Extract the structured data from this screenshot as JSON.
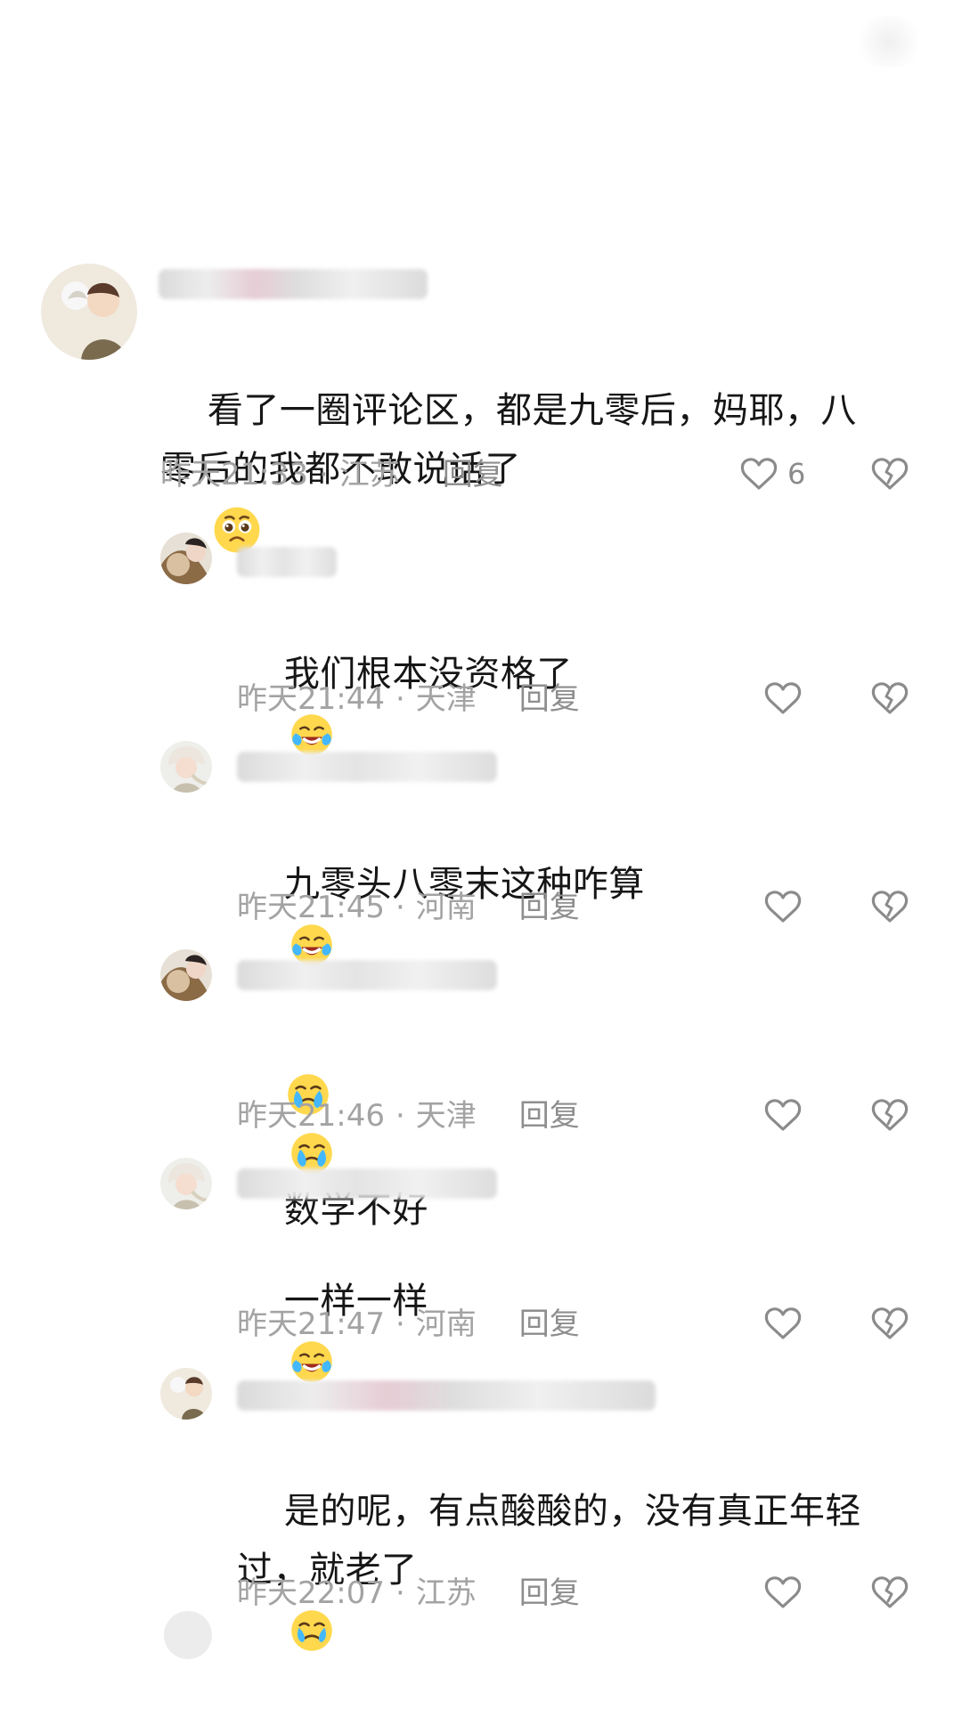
{
  "comments": [
    {
      "type": "main",
      "text": "看了一圈评论区，都是九零后，妈耶，八零后的我都不敢说话了",
      "time": "昨天21:33",
      "location": "江苏",
      "reply_label": "回复",
      "like_count": "6",
      "emoji_after": "pleading"
    },
    {
      "type": "reply",
      "text": "我们根本没资格了",
      "time": "昨天21:44",
      "location": "天津",
      "reply_label": "回复",
      "like_count": "",
      "emoji_after": "laughing"
    },
    {
      "type": "reply",
      "text": "九零头八零末这种咋算",
      "time": "昨天21:45",
      "location": "河南",
      "reply_label": "回复",
      "like_count": "",
      "emoji_after": "laughing"
    },
    {
      "type": "reply",
      "text": "数学不好",
      "time": "昨天21:46",
      "location": "天津",
      "reply_label": "回复",
      "like_count": "",
      "emoji_before": [
        "crying",
        "crying"
      ]
    },
    {
      "type": "reply",
      "text": "一样一样",
      "time": "昨天21:47",
      "location": "河南",
      "reply_label": "回复",
      "like_count": "",
      "emoji_after": "laughing"
    },
    {
      "type": "reply",
      "text": "是的呢，有点酸酸的，没有真正年轻过，就老了",
      "time": "昨天22:07",
      "location": "江苏",
      "reply_label": "回复",
      "like_count": "",
      "emoji_after": "sad"
    }
  ],
  "icons": {
    "like": "heart-outline-icon",
    "dislike": "broken-heart-icon",
    "emoji_pleading": "pleading-face-emoji",
    "emoji_laughing": "laughing-crying-emoji",
    "emoji_crying": "crying-face-emoji",
    "emoji_sad": "sad-face-emoji"
  },
  "colors": {
    "background": "#ffffff",
    "text": "#161616",
    "meta": "#a3a3a3",
    "icon": "#8b8b8b"
  }
}
